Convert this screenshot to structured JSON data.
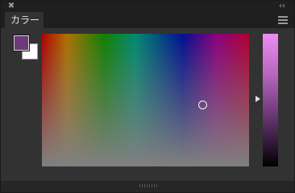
{
  "titlebar": {
    "close_icon": "✖",
    "collapse_icon": "‹‹"
  },
  "tabs": [
    {
      "label": "カラー"
    }
  ],
  "menu": {
    "icon": "hamburger-menu-icon"
  },
  "colors": {
    "foreground": "#6d3a78",
    "background": "#ffffff"
  },
  "picker": {
    "hue_fraction": 0.49
  }
}
